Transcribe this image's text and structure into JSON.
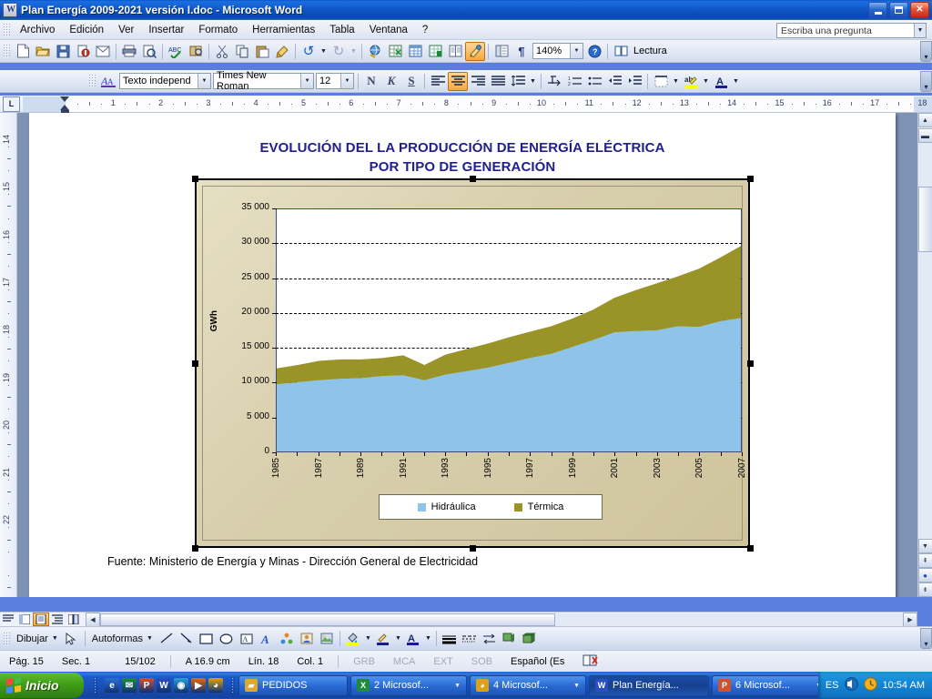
{
  "window": {
    "title": "Plan Energía 2009-2021 versión I.doc  -  Microsoft Word",
    "icon": "word-document-icon",
    "minimize": "–",
    "maximize": "□",
    "close": "✕"
  },
  "menu": {
    "items": [
      "Archivo",
      "Edición",
      "Ver",
      "Insertar",
      "Formato",
      "Herramientas",
      "Tabla",
      "Ventana",
      "?"
    ],
    "ask_placeholder": "Escriba una pregunta"
  },
  "toolbar_standard": {
    "buttons": [
      {
        "name": "new-document-icon",
        "glyph": "🗋"
      },
      {
        "name": "open-folder-icon",
        "glyph": "📂"
      },
      {
        "name": "save-icon",
        "glyph": "💾"
      },
      {
        "name": "permission-icon",
        "glyph": "🔒"
      },
      {
        "name": "email-icon",
        "glyph": "✉"
      },
      {
        "name": "print-icon",
        "glyph": "🖨"
      },
      {
        "name": "print-preview-icon",
        "glyph": "🔍"
      },
      {
        "name": "spelling-check-icon",
        "glyph": "ABC"
      },
      {
        "name": "research-icon",
        "glyph": "📖"
      },
      {
        "name": "cut-icon",
        "glyph": "✂"
      },
      {
        "name": "copy-icon",
        "glyph": "⧉"
      },
      {
        "name": "paste-icon",
        "glyph": "📋"
      },
      {
        "name": "format-painter-icon",
        "glyph": "🖌"
      },
      {
        "name": "undo-icon",
        "glyph": "↶"
      },
      {
        "name": "undo-dropdown-icon",
        "glyph": "▾"
      },
      {
        "name": "redo-icon",
        "glyph": "↷"
      },
      {
        "name": "redo-dropdown-icon",
        "glyph": "▾"
      },
      {
        "name": "insert-hyperlink-icon",
        "glyph": "🌐"
      },
      {
        "name": "insert-table-excel-icon",
        "glyph": "▦"
      },
      {
        "name": "insert-table-icon",
        "glyph": "⊞"
      },
      {
        "name": "insert-excel-sheet-icon",
        "glyph": "▤"
      },
      {
        "name": "columns-icon",
        "glyph": "▥"
      },
      {
        "name": "drawing-toggle-icon",
        "glyph": "✎"
      },
      {
        "name": "document-map-icon",
        "glyph": "🗺"
      },
      {
        "name": "show-formatting-marks-icon",
        "glyph": "¶"
      }
    ],
    "zoom_value": "140%",
    "help_icon": "help-question-icon",
    "reading_layout_label": "Lectura",
    "overflow": "▾"
  },
  "toolbar_formatting": {
    "styles_icon": "styles-and-formatting-icon",
    "style_value": "Texto independ",
    "font_value": "Times New Roman",
    "size_value": "12",
    "bold": "N",
    "italic": "K",
    "underline": "S",
    "align_left": "≡",
    "align_center": "≡",
    "align_right": "≡",
    "align_justify": "≡",
    "line_spacing": "↕≡",
    "overflow": "▾"
  },
  "ruler": {
    "tab_selector": "L",
    "horizontal_numbers": [
      "1",
      "2",
      "3",
      "4",
      "5",
      "6",
      "7",
      "8",
      "9",
      "10",
      "11",
      "12",
      "13",
      "14",
      "15",
      "16",
      "17",
      "18"
    ],
    "vertical_numbers": [
      "14",
      "15",
      "16",
      "17",
      "18",
      "19",
      "20",
      "21",
      "22"
    ]
  },
  "document": {
    "chart_title_line1": "EVOLUCIÓN DEL LA PRODUCCIÓN DE ENERGÍA ELÉCTRICA",
    "chart_title_line2": "POR TIPO DE GENERACIÓN",
    "source_note": "Fuente:  Ministerio de Energía y Minas - Dirección General de Electricidad"
  },
  "chart_data": {
    "type": "area",
    "stacked": true,
    "title": "EVOLUCIÓN DEL LA PRODUCCIÓN DE ENERGÍA ELÉCTRICA POR TIPO DE GENERACIÓN",
    "xlabel": "",
    "ylabel": "GWh",
    "ylim": [
      0,
      35000
    ],
    "yticks": [
      0,
      5000,
      10000,
      15000,
      20000,
      25000,
      30000,
      35000
    ],
    "ytick_labels": [
      "0",
      "5 000",
      "10 000",
      "15 000",
      "20 000",
      "25 000",
      "30 000",
      "35 000"
    ],
    "grid": "horizontal-dashed",
    "legend_position": "bottom",
    "x": [
      1985,
      1986,
      1987,
      1988,
      1989,
      1990,
      1991,
      1992,
      1993,
      1994,
      1995,
      1996,
      1997,
      1998,
      1999,
      2000,
      2001,
      2002,
      2003,
      2004,
      2005,
      2006,
      2007
    ],
    "xtick_labels": [
      "1985",
      "",
      "1987",
      "",
      "1989",
      "",
      "1991",
      "",
      "1993",
      "",
      "1995",
      "",
      "1997",
      "",
      "1999",
      "",
      "2001",
      "",
      "2003",
      "",
      "2005",
      "",
      "2007"
    ],
    "series": [
      {
        "name": "Hidráulica",
        "color": "#8ec3ea",
        "values": [
          9700,
          10000,
          10300,
          10500,
          10600,
          10900,
          11000,
          10300,
          11100,
          11600,
          12100,
          12800,
          13500,
          14100,
          15100,
          16100,
          17200,
          17400,
          17500,
          18100,
          18000,
          18800,
          19300
        ]
      },
      {
        "name": "Térmica",
        "color": "#9a9327",
        "values": [
          2300,
          2500,
          2800,
          2800,
          2700,
          2600,
          2900,
          2200,
          2900,
          3200,
          3500,
          3700,
          3800,
          4000,
          4100,
          4400,
          5000,
          5900,
          6800,
          7200,
          8400,
          9200,
          10400
        ]
      }
    ],
    "totals": [
      12000,
      12500,
      13100,
      13300,
      13300,
      13500,
      13900,
      12500,
      14000,
      14800,
      15600,
      16500,
      17300,
      18100,
      19200,
      20500,
      22200,
      23300,
      24300,
      25300,
      26400,
      28000,
      29700
    ]
  },
  "scrollbars": {
    "up_arrow": "▲",
    "down_arrow": "▼",
    "left_arrow": "◀",
    "right_arrow": "▶",
    "prev_page": "⇞",
    "select_browse": "●",
    "next_page": "⇟",
    "view_normal": "≡",
    "view_web": "▣",
    "view_print": "▤",
    "view_outline": "⋮≡",
    "view_reading": "◨"
  },
  "drawing_toolbar": {
    "draw_label": "Dibujar",
    "select_icon": "select-arrow-icon",
    "autoshapes_label": "Autoformas",
    "tools": [
      {
        "name": "line-icon",
        "glyph": "╲"
      },
      {
        "name": "arrow-icon",
        "glyph": "↘"
      },
      {
        "name": "rectangle-icon",
        "glyph": "▭"
      },
      {
        "name": "oval-icon",
        "glyph": "◯"
      },
      {
        "name": "text-box-icon",
        "glyph": "▤"
      },
      {
        "name": "wordart-icon",
        "glyph": "A"
      },
      {
        "name": "diagram-icon",
        "glyph": "❀"
      },
      {
        "name": "clipart-icon",
        "glyph": "▨"
      },
      {
        "name": "insert-picture-icon",
        "glyph": "▩"
      },
      {
        "name": "fill-color-icon",
        "glyph": "🪣"
      },
      {
        "name": "line-color-icon",
        "glyph": "🖊"
      },
      {
        "name": "font-color-icon",
        "glyph": "A"
      },
      {
        "name": "line-style-icon",
        "glyph": "≡"
      },
      {
        "name": "dash-style-icon",
        "glyph": "┈"
      },
      {
        "name": "arrow-style-icon",
        "glyph": "⇄"
      },
      {
        "name": "shadow-style-icon",
        "glyph": "▰"
      },
      {
        "name": "3d-style-icon",
        "glyph": "▰"
      }
    ]
  },
  "statusbar": {
    "page": "Pág.  15",
    "section": "Sec.  1",
    "pages": "15/102",
    "position": "A 16.9 cm",
    "line": "Lín.  18",
    "column": "Col.  1",
    "grb": "GRB",
    "mca": "MCA",
    "ext": "EXT",
    "sob": "SOB",
    "language": "Español (Es",
    "spell_icon": "spelling-status-icon"
  },
  "taskbar": {
    "start_label": "Inicio",
    "quick_launch": [
      {
        "name": "internet-explorer-icon",
        "glyph": "e",
        "color": "#2a6fd0"
      },
      {
        "name": "outlook-express-icon",
        "glyph": "✉",
        "color": "#1f8a3a"
      },
      {
        "name": "powerpoint-icon",
        "glyph": "P",
        "color": "#d4502a"
      },
      {
        "name": "word-icon",
        "glyph": "W",
        "color": "#2a4fc0"
      },
      {
        "name": "media-icon",
        "glyph": "◉",
        "color": "#2a9fd0"
      },
      {
        "name": "windows-media-player-icon",
        "glyph": "▶",
        "color": "#e06a10"
      },
      {
        "name": "clock-icon",
        "glyph": "◕",
        "color": "#e0a010"
      }
    ],
    "buttons": [
      {
        "name": "taskbar-item-pedidos",
        "label": "PEDIDOS",
        "icon": "folder-icon",
        "active": false,
        "dropdown": false
      },
      {
        "name": "taskbar-item-excel-group",
        "label": "2 Microsof...",
        "icon": "excel-icon",
        "active": false,
        "dropdown": true
      },
      {
        "name": "taskbar-item-ie-group",
        "label": "4 Microsof...",
        "icon": "ie-icon",
        "active": false,
        "dropdown": true
      },
      {
        "name": "taskbar-item-word",
        "label": "Plan Energía...",
        "icon": "word-icon",
        "active": true,
        "dropdown": false
      },
      {
        "name": "taskbar-item-powerpoint-group",
        "label": "6 Microsof...",
        "icon": "powerpoint-icon",
        "active": false,
        "dropdown": true
      }
    ],
    "language": "ES",
    "volume_icon": "volume-icon",
    "tray_clock_icon": "tray-clock-icon",
    "clock": "10:54 AM"
  }
}
